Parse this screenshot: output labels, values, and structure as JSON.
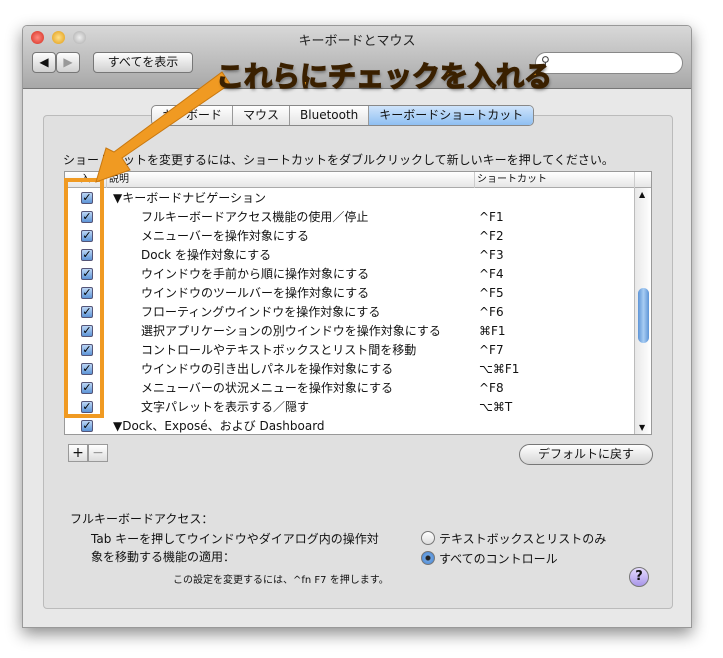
{
  "window": {
    "title": "キーボードとマウス",
    "show_all": "すべてを表示",
    "search_placeholder": ""
  },
  "tabs": [
    {
      "label": "キーボード"
    },
    {
      "label": "マウス"
    },
    {
      "label": "Bluetooth"
    },
    {
      "label": "キーボードショートカット",
      "selected": true
    }
  ],
  "hint": "ショートカットを変更するには、ショートカットをダブルクリックして新しいキーを押してください。",
  "table": {
    "columns": [
      "入",
      "説明",
      "ショートカット"
    ],
    "rows": [
      {
        "checked": true,
        "group": true,
        "desc": "▼キーボードナビゲーション",
        "shortcut": ""
      },
      {
        "checked": true,
        "desc": "フルキーボードアクセス機能の使用／停止",
        "shortcut": "^F1"
      },
      {
        "checked": true,
        "desc": "メニューバーを操作対象にする",
        "shortcut": "^F2"
      },
      {
        "checked": true,
        "desc": "Dock を操作対象にする",
        "shortcut": "^F3"
      },
      {
        "checked": true,
        "desc": "ウインドウを手前から順に操作対象にする",
        "shortcut": "^F4"
      },
      {
        "checked": true,
        "desc": "ウインドウのツールバーを操作対象にする",
        "shortcut": "^F5"
      },
      {
        "checked": true,
        "desc": "フローティングウインドウを操作対象にする",
        "shortcut": "^F6"
      },
      {
        "checked": true,
        "desc": "選択アプリケーションの別ウインドウを操作対象にする",
        "shortcut": "⌘F1"
      },
      {
        "checked": true,
        "desc": "コントロールやテキストボックスとリスト間を移動",
        "shortcut": "^F7"
      },
      {
        "checked": true,
        "desc": "ウインドウの引き出しパネルを操作対象にする",
        "shortcut": "⌥⌘F1"
      },
      {
        "checked": true,
        "desc": "メニューバーの状況メニューを操作対象にする",
        "shortcut": "^F8"
      },
      {
        "checked": true,
        "desc": "文字パレットを表示する／隠す",
        "shortcut": "⌥⌘T"
      },
      {
        "checked": true,
        "group": true,
        "desc": "▼Dock、Exposé、および Dashboard",
        "shortcut": ""
      }
    ]
  },
  "buttons": {
    "add": "+",
    "remove": "−",
    "restore_defaults": "デフォルトに戻す",
    "help": "?"
  },
  "full_keyboard": {
    "heading": "フルキーボードアクセス：",
    "label_line1": "Tab キーを押してウインドウやダイアログ内の操作対",
    "label_line2": "象を移動する機能の適用：",
    "option1": "テキストボックスとリストのみ",
    "option2": "すべてのコントロール",
    "selected": "option2",
    "note": "この設定を変更するには、^fn F7 を押します。"
  },
  "annotation": {
    "text": "これらにチェックを入れる",
    "color": "#f09a22"
  }
}
